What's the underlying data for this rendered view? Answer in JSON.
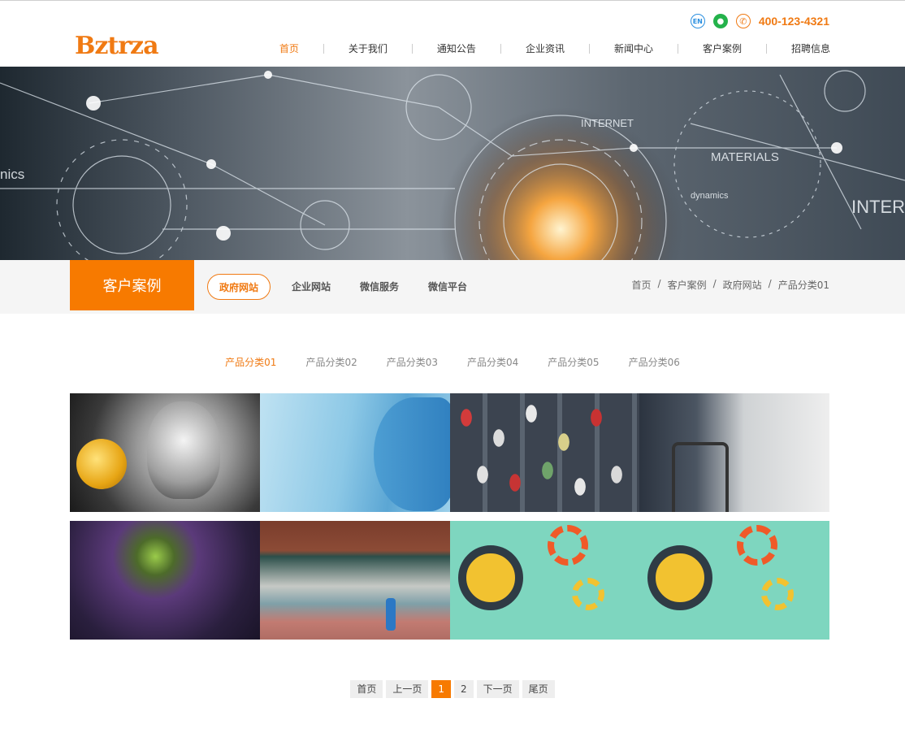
{
  "header": {
    "logo_text": "Bztrza",
    "en_icon_label": "EN",
    "phone": "400-123-4321",
    "nav": [
      {
        "label": "首页",
        "active": true
      },
      {
        "label": "关于我们"
      },
      {
        "label": "通知公告"
      },
      {
        "label": "企业资讯"
      },
      {
        "label": "新闻中心"
      },
      {
        "label": "客户案例"
      },
      {
        "label": "招聘信息"
      }
    ]
  },
  "banner": {
    "words": [
      "INTERNET",
      "MATERIALS",
      "dynamics",
      "nics",
      "INTER"
    ]
  },
  "subbar": {
    "section_title": "客户案例",
    "tabs": [
      {
        "label": "政府网站",
        "active": true
      },
      {
        "label": "企业网站"
      },
      {
        "label": "微信服务"
      },
      {
        "label": "微信平台"
      }
    ],
    "breadcrumb": [
      "首页",
      "客户案例",
      "政府网站",
      "产品分类01"
    ],
    "breadcrumb_sep": "/"
  },
  "categories": [
    "产品分类01",
    "产品分类02",
    "产品分类03",
    "产品分类04",
    "产品分类05",
    "产品分类06"
  ],
  "pagination": {
    "first": "首页",
    "prev": "上一页",
    "pages": [
      "1",
      "2"
    ],
    "current": "1",
    "next": "下一页",
    "last": "尾页"
  },
  "colors": {
    "accent": "#f77a00",
    "accent_text": "#f07a13",
    "wechat_green": "#24b24b",
    "en_blue": "#2a8fe0"
  }
}
